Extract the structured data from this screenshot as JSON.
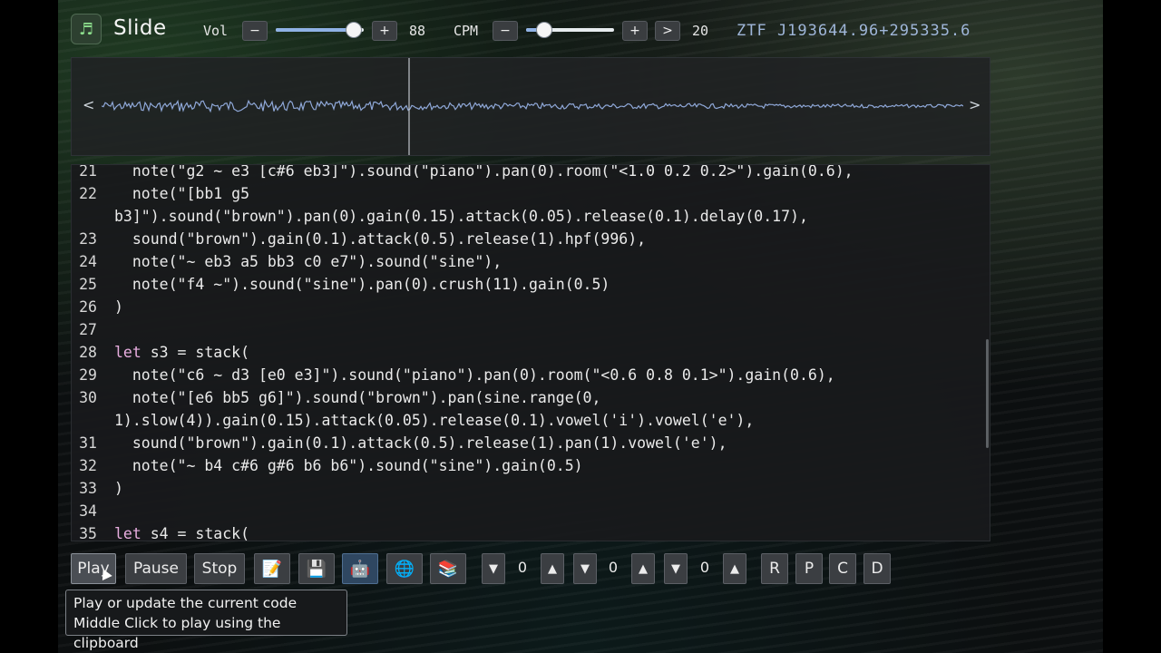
{
  "header": {
    "app_icon": "music-note-icon",
    "title": "Slide",
    "vol_label": "Vol",
    "vol_value": "88",
    "vol_level": 0.88,
    "cpm_label": "CPM",
    "cpm_value": "20",
    "cpm_level": 0.2,
    "minus_label": "−",
    "plus_label": "+",
    "next_label": ">",
    "object_id": "ZTF J193644.96+295335.6"
  },
  "waveform": {
    "prev_label": "<",
    "next_label": ">"
  },
  "editor": {
    "lines": [
      {
        "n": "21",
        "text": "  note(\"g2 ~ e3 [c#6 eb3]\").sound(\"piano\").pan(0).room(\"<1.0 0.2 0.2>\").gain(0.6),"
      },
      {
        "n": "22",
        "text": "  note(\"[bb1 g5"
      },
      {
        "n": "",
        "text": "b3]\").sound(\"brown\").pan(0).gain(0.15).attack(0.05).release(0.1).delay(0.17),"
      },
      {
        "n": "23",
        "text": "  sound(\"brown\").gain(0.1).attack(0.5).release(1).hpf(996),"
      },
      {
        "n": "24",
        "text": "  note(\"~ eb3 a5 bb3 c0 e7\").sound(\"sine\"),"
      },
      {
        "n": "25",
        "text": "  note(\"f4 ~\").sound(\"sine\").pan(0).crush(11).gain(0.5)"
      },
      {
        "n": "26",
        "text": ")"
      },
      {
        "n": "27",
        "text": ""
      },
      {
        "n": "28",
        "text": "let s3 = stack("
      },
      {
        "n": "29",
        "text": "  note(\"c6 ~ d3 [e0 e3]\").sound(\"piano\").pan(0).room(\"<0.6 0.8 0.1>\").gain(0.6),"
      },
      {
        "n": "30",
        "text": "  note(\"[e6 bb5 g6]\").sound(\"brown\").pan(sine.range(0,"
      },
      {
        "n": "",
        "text": "1).slow(4)).gain(0.15).attack(0.05).release(0.1).vowel('i').vowel('e'),"
      },
      {
        "n": "31",
        "text": "  sound(\"brown\").gain(0.1).attack(0.5).release(1).pan(1).vowel('e'),"
      },
      {
        "n": "32",
        "text": "  note(\"~ b4 c#6 g#6 b6 b6\").sound(\"sine\").gain(0.5)"
      },
      {
        "n": "33",
        "text": ")"
      },
      {
        "n": "34",
        "text": ""
      },
      {
        "n": "35",
        "text": "let s4 = stack("
      }
    ]
  },
  "toolbar": {
    "play_label": "Play",
    "pause_label": "Pause",
    "stop_label": "Stop",
    "icons": [
      "memo-icon",
      "floppy-disk-icon",
      "robot-icon",
      "globe-icon",
      "books-icon"
    ],
    "down_label": "▼",
    "up_label": "▲",
    "spinner_values": [
      "0",
      "0",
      "0"
    ],
    "r_label": "R",
    "p_label": "P",
    "c_label": "C",
    "d_label": "D"
  },
  "tooltip": {
    "line1": "Play or update the current code",
    "line2": "Middle Click to play using the clipboard"
  },
  "colors": {
    "slider_fill": "#8fb2e5",
    "keyword": "#e9aee0",
    "object_id": "#9fb6d9",
    "waveform": "#8fa8d8"
  }
}
